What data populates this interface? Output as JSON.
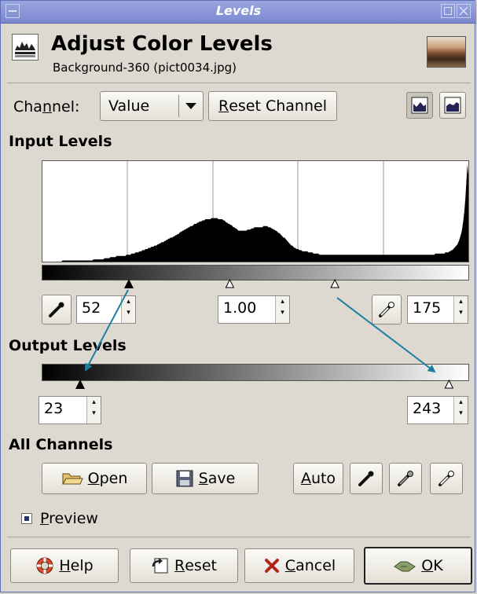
{
  "window": {
    "title": "Levels"
  },
  "header": {
    "title": "Adjust Color Levels",
    "subtitle": "Background-360 (pict0034.jpg)"
  },
  "channel": {
    "label_pre": "Cha",
    "label_mn": "n",
    "label_post": "nel:",
    "value": "Value",
    "reset_pre": "R",
    "reset_post": "eset Channel"
  },
  "input_levels": {
    "heading": "Input Levels",
    "low": "52",
    "gamma": "1.00",
    "high": "175",
    "low_fraction": 0.204,
    "gamma_fraction": 0.44,
    "high_fraction": 0.686
  },
  "output_levels": {
    "heading": "Output Levels",
    "low": "23",
    "high": "243",
    "low_fraction": 0.09,
    "high_fraction": 0.953
  },
  "all_channels": {
    "heading": "All Channels",
    "open_mn": "O",
    "open_rest": "pen",
    "save_mn": "S",
    "save_rest": "ave",
    "auto_mn": "A",
    "auto_rest": "uto"
  },
  "preview": {
    "mn": "P",
    "rest": "review",
    "checked": true
  },
  "footer": {
    "help_mn": "H",
    "help_rest": "elp",
    "reset_mn": "R",
    "reset_rest": "eset",
    "cancel_mn": "C",
    "cancel_rest": "ancel",
    "ok_mn": "O",
    "ok_rest": "K"
  },
  "colors": {
    "title_bar": "#8491d4",
    "window_bg": "#ddd9d0",
    "arrow": "#1f7ea0"
  },
  "histogram": [
    0,
    0,
    0,
    0,
    0,
    0,
    0,
    0,
    0,
    0,
    0,
    0,
    0,
    0,
    0,
    0,
    0,
    0,
    0,
    0,
    1,
    1,
    1,
    1,
    1,
    1,
    1,
    1,
    1,
    1,
    1,
    1,
    1,
    1,
    1,
    1,
    1,
    1,
    1,
    1,
    1,
    1,
    1,
    1,
    1,
    1,
    1,
    1,
    1,
    1,
    1,
    2,
    2,
    2,
    2,
    2,
    2,
    2,
    2,
    2,
    2,
    2,
    3,
    3,
    3,
    3,
    3,
    3,
    4,
    4,
    4,
    4,
    4,
    4,
    5,
    5,
    5,
    5,
    5,
    5,
    5,
    5,
    5,
    5,
    6,
    6,
    6,
    6,
    6,
    7,
    7,
    7,
    7,
    8,
    8,
    8,
    8,
    9,
    9,
    9,
    10,
    10,
    10,
    11,
    11,
    11,
    12,
    12,
    12,
    13,
    13,
    13,
    14,
    14,
    14,
    15,
    15,
    16,
    16,
    17,
    17,
    17,
    18,
    18,
    19,
    19,
    20,
    20,
    21,
    21,
    21,
    22,
    22,
    23,
    23,
    24,
    24,
    25,
    26,
    26,
    27,
    27,
    28,
    28,
    29,
    29,
    30,
    30,
    31,
    31,
    31,
    32,
    33,
    33,
    33,
    34,
    34,
    35,
    35,
    35,
    36,
    36,
    36,
    37,
    37,
    37,
    37,
    37,
    37,
    38,
    38,
    38,
    38,
    38,
    38,
    38,
    37,
    37,
    37,
    37,
    37,
    36,
    36,
    35,
    34,
    34,
    33,
    33,
    32,
    32,
    31,
    30,
    30,
    29,
    29,
    28,
    27,
    27,
    27,
    27,
    27,
    27,
    27,
    27,
    27,
    28,
    28,
    28,
    28,
    29,
    29,
    29,
    30,
    30,
    30,
    30,
    30,
    30,
    30,
    30,
    30,
    31,
    31,
    31,
    31,
    31,
    30,
    30,
    30,
    29,
    29,
    28,
    28,
    27,
    27,
    26,
    25,
    25,
    24,
    23,
    22,
    21,
    21,
    20,
    19,
    18,
    17,
    16,
    15,
    14,
    14,
    13,
    12,
    12,
    11,
    11,
    11,
    10,
    10,
    10,
    9,
    9,
    9,
    9,
    9,
    9,
    8,
    8,
    8,
    8,
    8,
    7,
    7,
    7,
    7,
    7,
    7,
    6,
    6,
    6,
    6,
    6,
    6,
    6,
    6,
    6,
    6,
    6,
    6,
    6,
    6,
    6,
    6,
    6,
    6,
    6,
    6,
    6,
    6,
    6,
    6,
    6,
    6,
    6,
    6,
    6,
    6,
    6,
    6,
    6,
    6,
    6,
    6,
    6,
    6,
    6,
    6,
    6,
    6,
    6,
    6,
    6,
    6,
    6,
    6,
    6,
    6,
    6,
    6,
    6,
    6,
    6,
    6,
    6,
    6,
    6,
    6,
    6,
    6,
    6,
    6,
    6,
    6,
    6,
    6,
    6,
    6,
    6,
    6,
    6,
    6,
    6,
    6,
    6,
    6,
    6,
    6,
    6,
    6,
    6,
    6,
    6,
    6,
    6,
    6,
    6,
    6,
    6,
    6,
    6,
    6,
    6,
    6,
    6,
    6,
    6,
    6,
    6,
    6,
    6,
    6,
    6,
    6,
    6,
    6,
    6,
    6,
    6,
    6,
    6,
    6,
    6,
    6,
    7,
    7,
    7,
    7,
    7,
    7,
    7,
    7,
    7,
    7,
    8,
    8,
    8,
    8,
    9,
    9,
    10,
    10,
    11,
    12,
    13,
    14,
    15,
    17,
    19,
    22,
    25,
    30,
    36,
    44,
    55,
    70,
    85,
    75
  ]
}
